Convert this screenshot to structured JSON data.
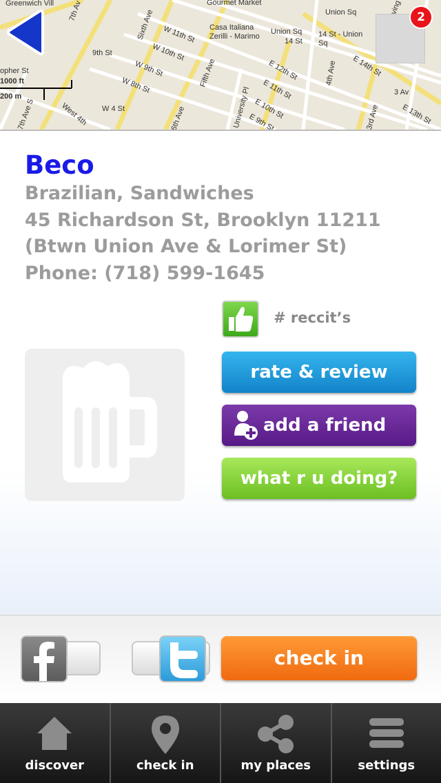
{
  "map": {
    "labels": [
      "Greenwich Vill",
      "Gourmet Market",
      "Union Sq",
      "Casa Italiana Zerilli - Marimo",
      "Union Sq",
      "14 St",
      "14 St - Union Sq",
      "W 11th St",
      "9th St",
      "W 10th St",
      "Fifth Ave",
      "E 14th St",
      "W 9th St",
      "E 12th St",
      "opher St",
      "W 8th St",
      "E 11th St",
      "3 Av",
      "1000 ft",
      "200 m",
      "W 4 St",
      "E 10th St",
      "4th Ave",
      "E 13th St",
      "University Pl",
      "E 9th St",
      "3rd Ave",
      "7th Ave S",
      "6th Ave",
      "Sixth Ave",
      "West 4th",
      "7th Av",
      "Irving"
    ],
    "scale_ft": "1000 ft",
    "scale_m": "200 m"
  },
  "nav": {
    "back_icon": "back-arrow-icon",
    "notification_count": "2"
  },
  "venue": {
    "name": "Beco",
    "category": "Brazilian, Sandwiches",
    "address": "45 Richardson St, Brooklyn 11211",
    "cross_streets": "(Btwn Union Ave & Lorimer St)",
    "phone": "Phone: (718) 599-1645",
    "reccits_label": "# reccit’s",
    "photo_icon": "beer-mug-icon"
  },
  "actions": {
    "rate_review": "rate & review",
    "add_friend": "add a friend",
    "what_doing": "what r u doing?",
    "check_in": "check in"
  },
  "share": {
    "facebook_icon": "facebook-icon",
    "twitter_icon": "twitter-icon"
  },
  "tabs": [
    {
      "label": "discover",
      "icon": "home-icon"
    },
    {
      "label": "check in",
      "icon": "map-pin-icon"
    },
    {
      "label": "my places",
      "icon": "share-icon"
    },
    {
      "label": "settings",
      "icon": "menu-icon"
    }
  ],
  "colors": {
    "venue_name": "#1a1ae8",
    "info_text": "#9c9c9c",
    "rate_button": "#1e9be0",
    "friend_button": "#64238f",
    "doing_button": "#86d03a",
    "checkin_button": "#f58222",
    "badge": "#e8141a"
  }
}
